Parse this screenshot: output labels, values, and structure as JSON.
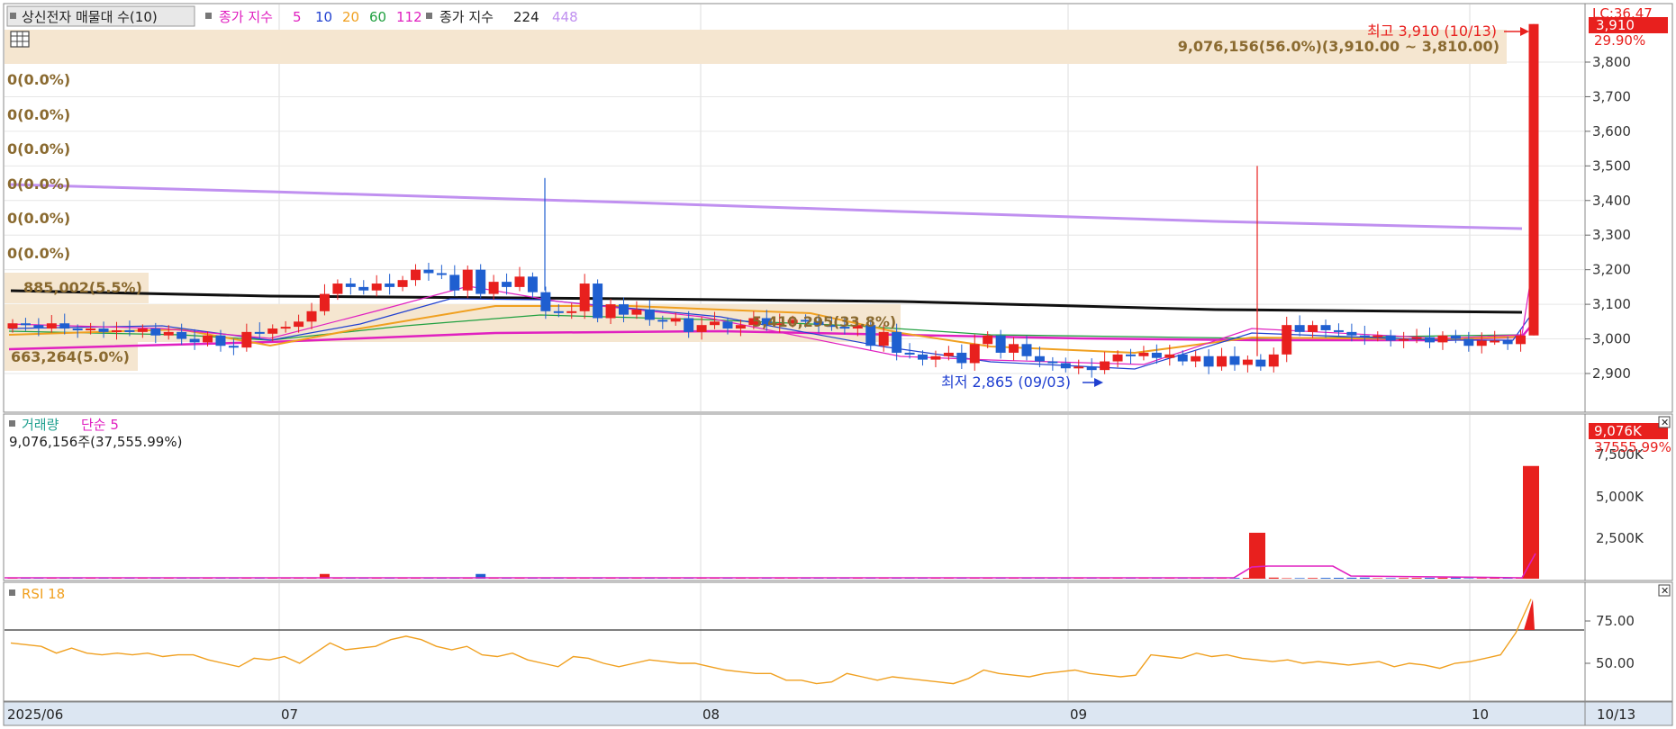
{
  "price_panel": {
    "legend_item": "상신전자 매물대 수(10)",
    "ma_label_prefix": "종가 지수",
    "ma_short": [
      {
        "label": "5",
        "color": "#e020c0"
      },
      {
        "label": "10",
        "color": "#2040d0"
      },
      {
        "label": "20",
        "color": "#f0a020"
      },
      {
        "label": "60",
        "color": "#20a040"
      },
      {
        "label": "112",
        "color": "#e020c0"
      }
    ],
    "ma_long_prefix": "종가 지수",
    "ma_long": [
      {
        "label": "224",
        "color": "#202020"
      },
      {
        "label": "448",
        "color": "#c090f0"
      }
    ],
    "high_label": "최고 3,910 (10/13)",
    "low_label": "최저 2,865 (09/03)",
    "current_price": "3,910",
    "current_change": "29.90%",
    "top_right_code": "LC:36.47",
    "volume_profile_labels": [
      "9,076,156(56.0%)(3,910.00 ~ 3,810.00)",
      "0(0.0%)",
      "0(0.0%)",
      "0(0.0%)",
      "0(0.0%)",
      "0(0.0%)",
      "0(0.0%)",
      "885,002(5.5%)",
      "5,410,295(33.8%)",
      "663,264(5.0%)"
    ]
  },
  "volume_panel": {
    "title": "거래량",
    "ma_label": "단순 5",
    "info": "9,076,156주(37,555.99%)",
    "current_value": "9,076K",
    "current_pct": "37555.99%"
  },
  "rsi_panel": {
    "title": "RSI 18"
  },
  "colors": {
    "up": "#e8201e",
    "down": "#1f5fd0",
    "ma448": "#c090f0",
    "ma224": "#101010",
    "rsi_line": "#f0a020",
    "profile_band": "#f5e6d0"
  },
  "chart_data": [
    {
      "type": "candlestick",
      "title": "",
      "x_tick_labels": [
        "2025/06",
        "07",
        "08",
        "09",
        "10",
        "10/13"
      ],
      "y_ticks": [
        "3,800",
        "3,700",
        "3,600",
        "3,500",
        "3,400",
        "3,300",
        "3,200",
        "3,100",
        "3,000",
        "2,900"
      ],
      "ylim": [
        2800,
        3950
      ],
      "high": {
        "value": 3910,
        "date": "10/13"
      },
      "low": {
        "value": 2865,
        "date": "09/03"
      },
      "last_candle": {
        "open": 3010,
        "close": 3910,
        "high": 3910,
        "low": 3010
      },
      "ma448_start": 3440,
      "ma448_end": 3320,
      "ma224_start": 3130,
      "ma224_end": 3075,
      "volume_profile": [
        {
          "range": "3,910.00 ~ 3,810.00",
          "volume": 9076156,
          "pct": 56.0
        },
        {
          "volume": 885002,
          "pct": 5.5
        },
        {
          "volume": 5410295,
          "pct": 33.8
        },
        {
          "volume": 663264,
          "pct": 5.0
        }
      ]
    },
    {
      "type": "bar",
      "title": "",
      "y_ticks": [
        "7,500K",
        "5,000K",
        "2,500K"
      ],
      "ylim": [
        0,
        10000
      ],
      "spikes": [
        {
          "date": "09/19",
          "value": 3700
        },
        {
          "date": "10/13",
          "value": 9076
        }
      ]
    },
    {
      "type": "line",
      "title": "",
      "y_ticks": [
        "75.00",
        "50.00"
      ],
      "ylim": [
        30,
        100
      ],
      "last_value": 88
    }
  ]
}
